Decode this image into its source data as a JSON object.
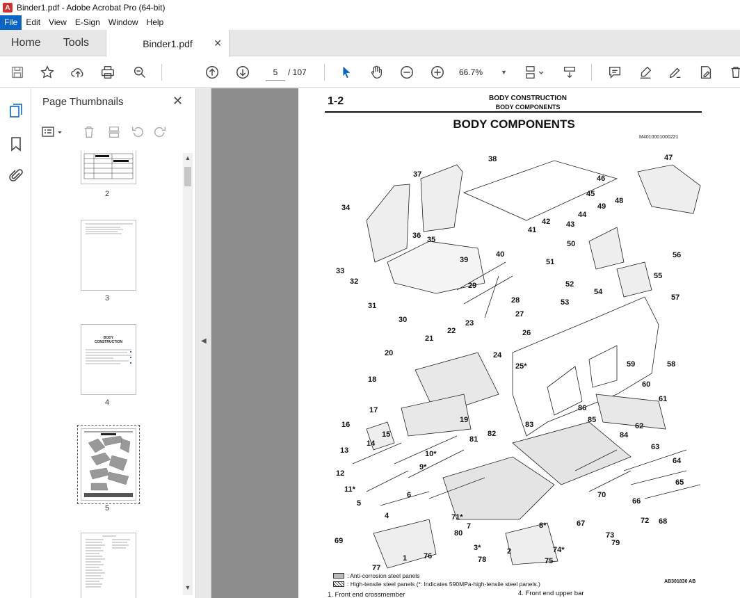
{
  "window": {
    "title": "Binder1.pdf - Adobe Acrobat Pro (64-bit)",
    "app_icon": "acrobat-icon"
  },
  "menu": [
    "File",
    "Edit",
    "View",
    "E-Sign",
    "Window",
    "Help"
  ],
  "tabs": {
    "home": "Home",
    "tools": "Tools",
    "document": "Binder1.pdf"
  },
  "toolbar": {
    "current_page": "5",
    "total_pages": "/ 107",
    "zoom": "66.7%",
    "accent_color": "#0a64c8"
  },
  "thumbnails_panel": {
    "title": "Page Thumbnails",
    "pages": [
      {
        "label": "2"
      },
      {
        "label": "3"
      },
      {
        "label": "4"
      },
      {
        "label": "5",
        "selected": true
      },
      {
        "label": ""
      }
    ],
    "page4_title_lines": [
      "BODY",
      "CONSTRUCTION"
    ]
  },
  "document_page": {
    "section_number": "1-2",
    "header_line1": "BODY CONSTRUCTION",
    "header_line2": "BODY COMPONENTS",
    "title": "BODY COMPONENTS",
    "code": "M4010001000221",
    "figure_id": "AB301830 AB",
    "legend": [
      {
        "swatch": "grey",
        "text": ": Anti-corrosion steel panels"
      },
      {
        "swatch": "hatch",
        "text": ": High-tensile steel panels (*: Indicates 590MPa-high-tensile steel panels.)"
      }
    ],
    "list_item_1": "1.      Front end crossmember",
    "list_item_4": "4.      Front end upper bar",
    "callouts": [
      "38",
      "47",
      "37",
      "46",
      "45",
      "34",
      "44",
      "49",
      "48",
      "42",
      "43",
      "41",
      "36",
      "35",
      "50",
      "40",
      "39",
      "56",
      "33",
      "32",
      "51",
      "52",
      "55",
      "29",
      "54",
      "28",
      "31",
      "53",
      "57",
      "27",
      "30",
      "23",
      "26",
      "22",
      "21",
      "24",
      "59",
      "58",
      "25*",
      "20",
      "18",
      "60",
      "86",
      "61",
      "19",
      "17",
      "85",
      "84",
      "83",
      "62",
      "16",
      "15",
      "81",
      "82",
      "14",
      "63",
      "13",
      "10*",
      "64",
      "12",
      "9*",
      "65",
      "11*",
      "6",
      "70",
      "66",
      "5",
      "4",
      "72",
      "8*",
      "71*",
      "7",
      "68",
      "67",
      "73",
      "80",
      "69",
      "3*",
      "79",
      "74*",
      "76",
      "2",
      "78",
      "1",
      "77",
      "75"
    ]
  }
}
